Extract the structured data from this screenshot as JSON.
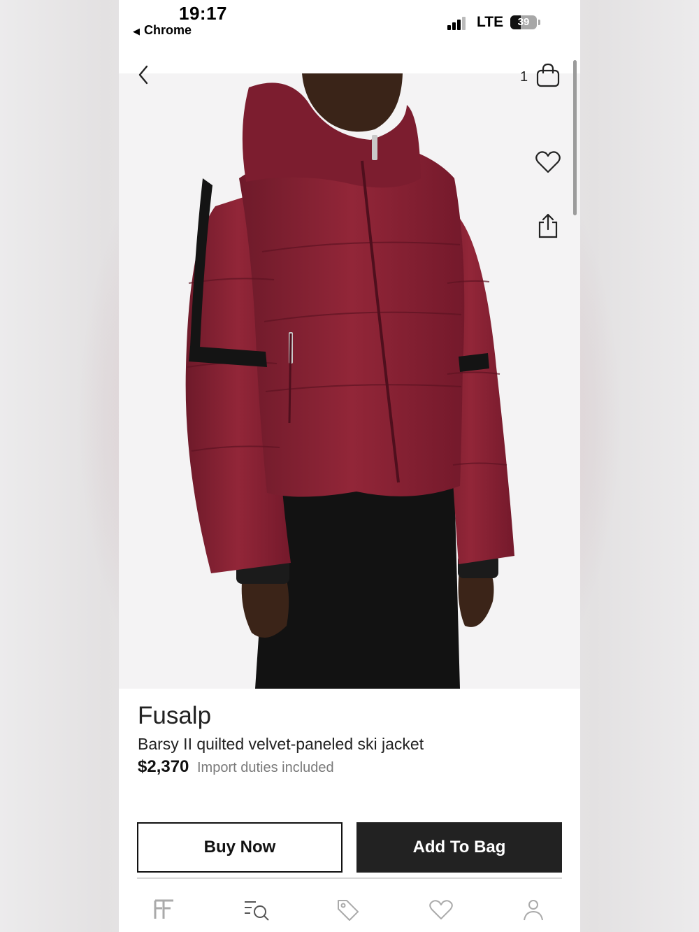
{
  "status_bar": {
    "time": "19:17",
    "back_app": "Chrome",
    "network": "LTE",
    "battery": "39",
    "battery_level": 0.39
  },
  "header": {
    "bag_count": "1",
    "icons": [
      "back-icon",
      "shopping-bag-icon",
      "heart-icon",
      "share-icon"
    ]
  },
  "gallery": {
    "image_count": 6,
    "active_index": 0
  },
  "product": {
    "brand": "Fusalp",
    "name": "Barsy II quilted velvet-paneled ski jacket",
    "price": "$2,370",
    "price_note": "Import duties included"
  },
  "actions": {
    "buy_now": "Buy Now",
    "add_to_bag": "Add To Bag"
  },
  "tabbar": {
    "items": [
      {
        "icon": "farfetch-logo-icon"
      },
      {
        "icon": "search-icon"
      },
      {
        "icon": "tag-icon"
      },
      {
        "icon": "heart-icon"
      },
      {
        "icon": "profile-icon"
      }
    ]
  },
  "colors": {
    "jacket": "#8a2335",
    "button_dark": "#222222"
  }
}
